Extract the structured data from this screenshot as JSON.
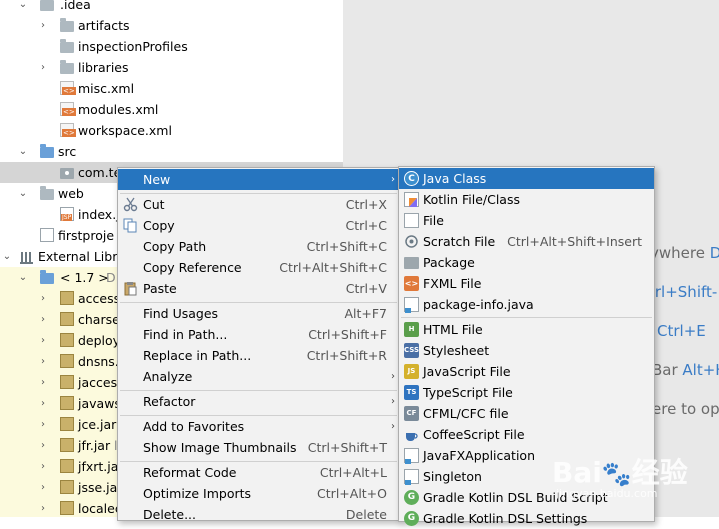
{
  "tree": {
    "rows": [
      {
        "label": ".idea"
      },
      {
        "label": "artifacts"
      },
      {
        "label": "inspectionProfiles"
      },
      {
        "label": "libraries"
      },
      {
        "label": "misc.xml"
      },
      {
        "label": "modules.xml"
      },
      {
        "label": "workspace.xml"
      },
      {
        "label": "src"
      },
      {
        "label": "com.te"
      },
      {
        "label": "web"
      },
      {
        "label": "index.js"
      },
      {
        "label": "firstproje"
      },
      {
        "label": "External Libra"
      },
      {
        "label": "< 1.7 >",
        "extra": "D"
      },
      {
        "label": "access",
        "extra": ""
      },
      {
        "label": "charset"
      },
      {
        "label": "deploy"
      },
      {
        "label": "dnsns.j"
      },
      {
        "label": "jaccess"
      },
      {
        "label": "javaws"
      },
      {
        "label": "jce.jar"
      },
      {
        "label": "jfr.jar",
        "extra": "l"
      },
      {
        "label": "jfxrt.jar"
      },
      {
        "label": "jsse.jar"
      },
      {
        "label": "localec"
      }
    ]
  },
  "editor": {
    "hints": [
      {
        "text": "ywhere ",
        "key": "D"
      },
      {
        "text": "",
        "key": "trl+Shift-"
      },
      {
        "text": "",
        "key": "Ctrl+E"
      },
      {
        "text": "Bar ",
        "key": "Alt+H"
      },
      {
        "text": "ere to op",
        "key": ""
      }
    ]
  },
  "context_menu": {
    "items": [
      {
        "label": "New"
      },
      {
        "label": "Cut",
        "shortcut": "Ctrl+X"
      },
      {
        "label": "Copy",
        "shortcut": "Ctrl+C"
      },
      {
        "label": "Copy Path",
        "shortcut": "Ctrl+Shift+C"
      },
      {
        "label": "Copy Reference",
        "shortcut": "Ctrl+Alt+Shift+C"
      },
      {
        "label": "Paste",
        "shortcut": "Ctrl+V"
      },
      {
        "label": "Find Usages",
        "shortcut": "Alt+F7"
      },
      {
        "label": "Find in Path...",
        "shortcut": "Ctrl+Shift+F"
      },
      {
        "label": "Replace in Path...",
        "shortcut": "Ctrl+Shift+R"
      },
      {
        "label": "Analyze"
      },
      {
        "label": "Refactor"
      },
      {
        "label": "Add to Favorites"
      },
      {
        "label": "Show Image Thumbnails",
        "shortcut": "Ctrl+Shift+T"
      },
      {
        "label": "Reformat Code",
        "shortcut": "Ctrl+Alt+L"
      },
      {
        "label": "Optimize Imports",
        "shortcut": "Ctrl+Alt+O"
      },
      {
        "label": "Delete...",
        "shortcut": "Delete"
      }
    ]
  },
  "new_submenu": {
    "items": [
      {
        "label": "Java Class",
        "icon": "C"
      },
      {
        "label": "Kotlin File/Class"
      },
      {
        "label": "File"
      },
      {
        "label": "Scratch File",
        "shortcut": "Ctrl+Alt+Shift+Insert"
      },
      {
        "label": "Package"
      },
      {
        "label": "FXML File",
        "icon": "<>"
      },
      {
        "label": "package-info.java"
      },
      {
        "label": "HTML File",
        "icon": "H"
      },
      {
        "label": "Stylesheet",
        "icon": "CSS"
      },
      {
        "label": "JavaScript File",
        "icon": "JS"
      },
      {
        "label": "TypeScript File",
        "icon": "TS"
      },
      {
        "label": "CFML/CFC file",
        "icon": "CF"
      },
      {
        "label": "CoffeeScript File"
      },
      {
        "label": "JavaFXApplication"
      },
      {
        "label": "Singleton"
      },
      {
        "label": "Gradle Kotlin DSL Build Script",
        "icon": "G"
      },
      {
        "label": "Gradle Kotlin DSL Settings",
        "icon": "G"
      }
    ]
  },
  "watermark": {
    "brand": "Bai",
    "brand2": "经验",
    "url": "jingyan.baidu.com"
  }
}
